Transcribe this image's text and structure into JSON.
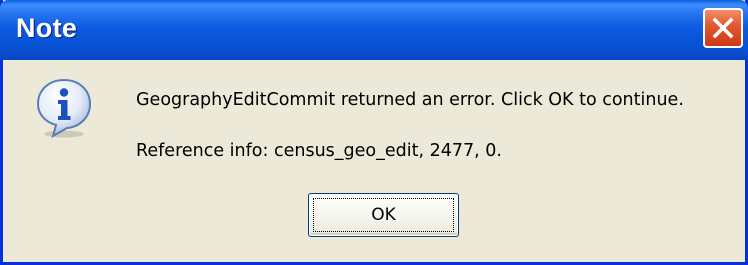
{
  "dialog": {
    "title": "Note",
    "message": "GeographyEditCommit returned an error.  Click OK to continue.",
    "reference": "Reference info: census_geo_edit, 2477, 0.",
    "ok_label": "OK",
    "icon": "information-icon",
    "close_icon": "close-icon"
  },
  "colors": {
    "titlebar": "#0a55dd",
    "frame": "#0831d9",
    "body": "#ece9d8",
    "close_button": "#e0552c"
  }
}
